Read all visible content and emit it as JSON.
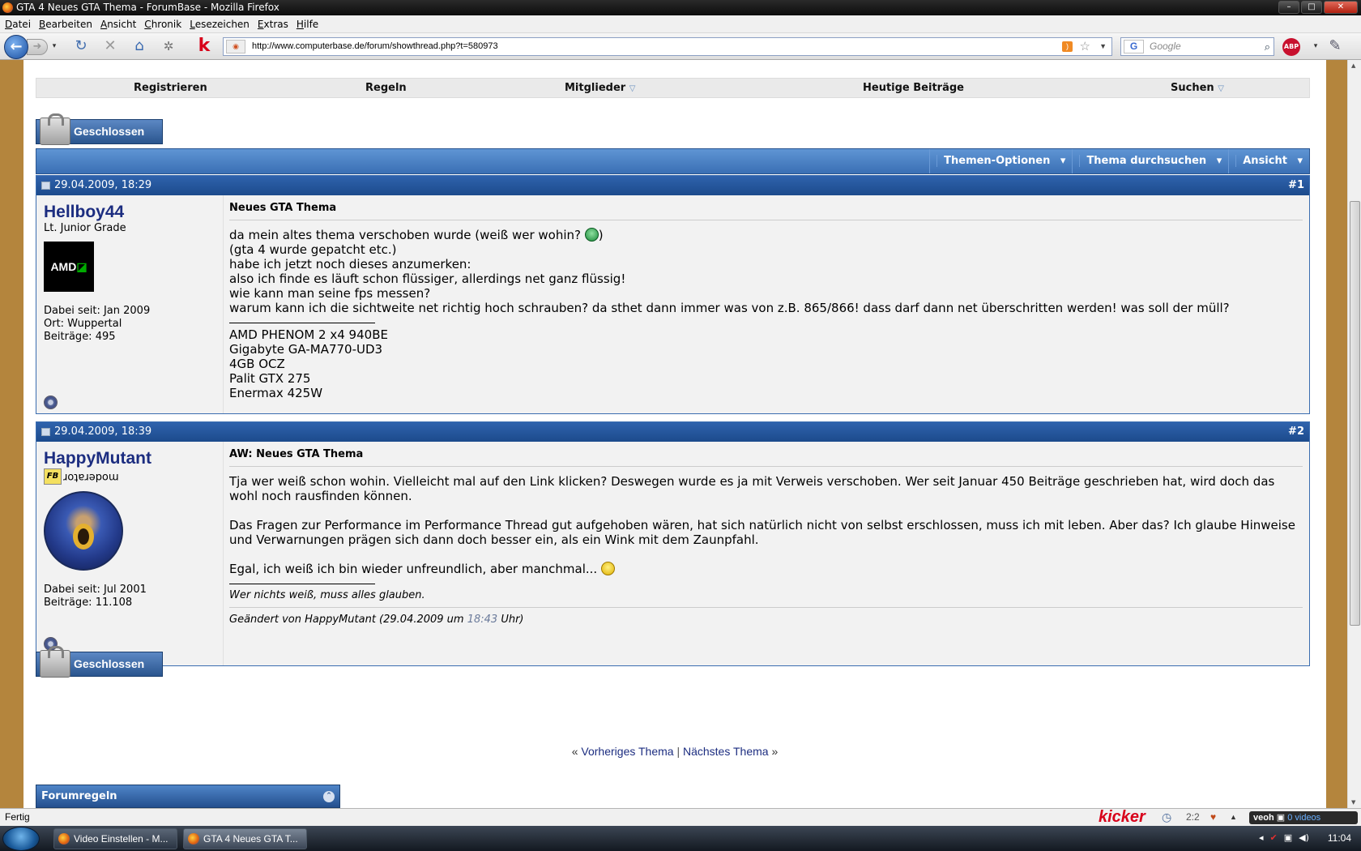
{
  "window": {
    "title": "GTA 4 Neues GTA Thema - ForumBase - Mozilla Firefox"
  },
  "menu": [
    "Datei",
    "Bearbeiten",
    "Ansicht",
    "Chronik",
    "Lesezeichen",
    "Extras",
    "Hilfe"
  ],
  "address": {
    "url": "http://www.computerbase.de/forum/showthread.php?t=580973"
  },
  "search": {
    "placeholder": "Google"
  },
  "forum_nav": [
    "Registrieren",
    "Regeln",
    "Mitglieder",
    "Heutige Beiträge",
    "Suchen"
  ],
  "closed_label": "Geschlossen",
  "thread_tools": [
    "Themen-Optionen",
    "Thema durchsuchen",
    "Ansicht"
  ],
  "posts": [
    {
      "date": "29.04.2009, 18:29",
      "number": "#1",
      "user": "Hellboy44",
      "rank": "Lt. Junior Grade",
      "avatar_text": "AMD",
      "joined": "Dabei seit: Jan 2009",
      "location": "Ort: Wuppertal",
      "posts_count": "Beiträge: 495",
      "title": "Neues GTA Thema",
      "lines": [
        "da mein altes thema verschoben wurde (weiß wer wohin? ",
        "(gta 4 wurde gepatcht etc.)",
        "habe ich jetzt noch dieses anzumerken:",
        "also ich finde es läuft schon flüssiger, allerdings net ganz flüssig!",
        "wie kann man seine fps messen?",
        "warum kann ich die sichtweite net richtig hoch schrauben? da sthet dann immer was von z.B. 865/866! dass darf dann net überschritten werden! was soll der müll?"
      ],
      "line1_end": ")",
      "signature": [
        "AMD PHENOM 2 x4 940BE",
        "Gigabyte GA-MA770-UD3",
        "4GB OCZ",
        "Palit GTX 275",
        "Enermax 425W"
      ]
    },
    {
      "date": "29.04.2009, 18:39",
      "number": "#2",
      "user": "HappyMutant",
      "rank": "moderator",
      "badge": "FB",
      "joined": "Dabei seit: Jul 2001",
      "posts_count": "Beiträge: 11.108",
      "title": "AW: Neues GTA Thema",
      "paragraphs": [
        "Tja wer weiß schon wohin. Vielleicht mal auf den Link klicken? Deswegen wurde es ja mit Verweis verschoben. Wer seit Januar 450 Beiträge geschrieben hat, wird doch das wohl noch rausfinden können.",
        "Das Fragen zur Performance im Performance Thread gut aufgehoben wären, hat sich natürlich nicht von selbst erschlossen, muss ich mit leben. Aber das? Ich glaube Hinweise und Verwarnungen prägen sich dann doch besser ein, als ein Wink mit dem Zaunpfahl.",
        "Egal, ich weiß ich bin wieder unfreundlich, aber manchmal... "
      ],
      "signature": "Wer nichts weiß, muss alles glauben.",
      "edited_prefix": "Geändert von HappyMutant (29.04.2009 um ",
      "edited_time": "18:43",
      "edited_suffix": " Uhr)"
    }
  ],
  "thread_nav": {
    "open": "«",
    "prev": "Vorheriges Thema",
    "sep": "|",
    "next": "Nächstes Thema",
    "close": "»"
  },
  "forum_rules": "Forumregeln",
  "status": {
    "text": "Fertig",
    "kicker": "kicker",
    "score": "2:2",
    "veoh": "veoh",
    "videos": "0 videos"
  },
  "taskbar": {
    "tasks": [
      "Video Einstellen - M...",
      "GTA 4 Neues GTA T..."
    ],
    "clock": "11:04"
  },
  "colors": {
    "link": "#1c2d80",
    "post_header": "#2f63ad",
    "page_bg": "#b4853d"
  }
}
